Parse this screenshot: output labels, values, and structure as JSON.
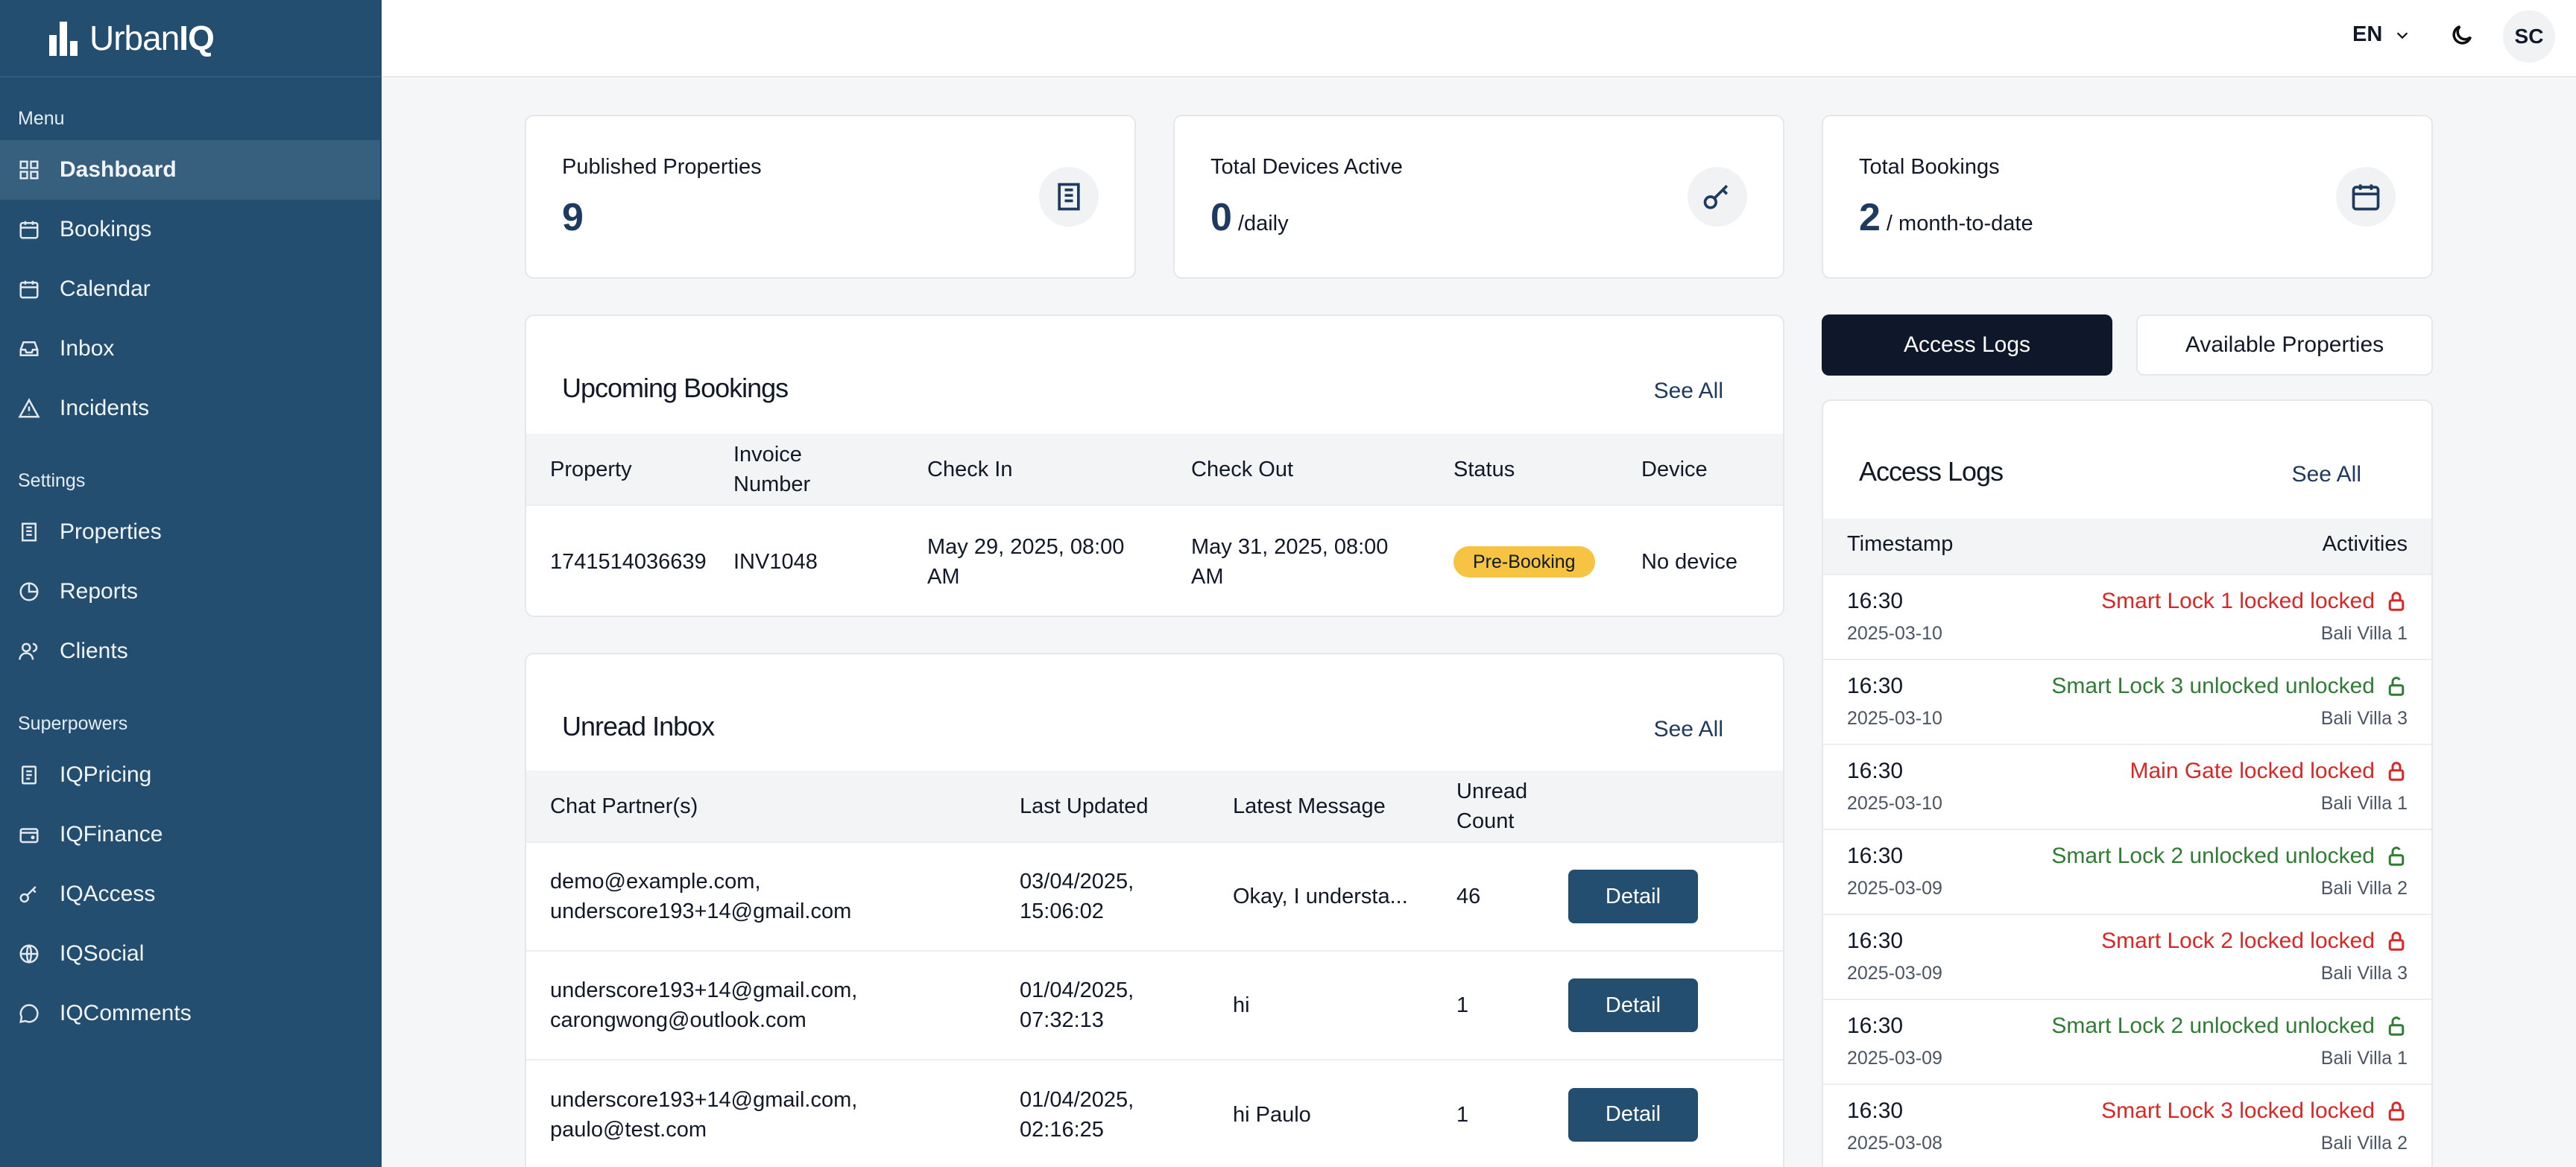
{
  "app": {
    "logo_text_bold": "Urban",
    "logo_text_accent": "IQ"
  },
  "sidebar": {
    "sections": [
      {
        "label": "Menu",
        "items": [
          {
            "label": "Dashboard",
            "icon": "grid-icon",
            "active": true
          },
          {
            "label": "Bookings",
            "icon": "calendar-icon"
          },
          {
            "label": "Calendar",
            "icon": "calendar-icon"
          },
          {
            "label": "Inbox",
            "icon": "inbox-icon"
          },
          {
            "label": "Incidents",
            "icon": "warning-icon"
          }
        ]
      },
      {
        "label": "Settings",
        "items": [
          {
            "label": "Properties",
            "icon": "building-icon"
          },
          {
            "label": "Reports",
            "icon": "pie-chart-icon"
          },
          {
            "label": "Clients",
            "icon": "users-icon"
          }
        ]
      },
      {
        "label": "Superpowers",
        "items": [
          {
            "label": "IQPricing",
            "icon": "receipt-icon"
          },
          {
            "label": "IQFinance",
            "icon": "wallet-icon"
          },
          {
            "label": "IQAccess",
            "icon": "key-icon"
          },
          {
            "label": "IQSocial",
            "icon": "globe-icon"
          },
          {
            "label": "IQComments",
            "icon": "chat-icon"
          }
        ]
      }
    ]
  },
  "topbar": {
    "language": "EN",
    "avatar_initials": "SC"
  },
  "stats": [
    {
      "title": "Published Properties",
      "value": "9",
      "unit": "",
      "icon": "building-icon"
    },
    {
      "title": "Total Devices Active",
      "value": "0",
      "unit": "/daily",
      "icon": "key-icon"
    },
    {
      "title": "Total Bookings",
      "value": "2",
      "unit": "/ month-to-date",
      "icon": "calendar-icon"
    }
  ],
  "upcoming": {
    "title": "Upcoming Bookings",
    "see_all": "See All",
    "headers": [
      "Property",
      "Invoice Number",
      "Check In",
      "Check Out",
      "Status",
      "Device"
    ],
    "rows": [
      {
        "property": "1741514036639",
        "invoice": "INV1048",
        "check_in": "May 29, 2025, 08:00 AM",
        "check_out": "May 31, 2025, 08:00 AM",
        "status": "Pre-Booking",
        "device": "No device"
      }
    ]
  },
  "inbox": {
    "title": "Unread Inbox",
    "see_all": "See All",
    "headers": [
      "Chat Partner(s)",
      "Last Updated",
      "Latest Message",
      "Unread Count",
      ""
    ],
    "detail_label": "Detail",
    "rows": [
      {
        "partners": "demo@example.com, underscore193+14@gmail.com",
        "updated": "03/04/2025, 15:06:02",
        "message": "Okay, I understa...",
        "count": "46"
      },
      {
        "partners": "underscore193+14@gmail.com, carongwong@outlook.com",
        "updated": "01/04/2025, 07:32:13",
        "message": "hi",
        "count": "1"
      },
      {
        "partners": "underscore193+14@gmail.com, paulo@test.com",
        "updated": "01/04/2025, 02:16:25",
        "message": "hi Paulo",
        "count": "1"
      }
    ]
  },
  "tabs": [
    {
      "label": "Access Logs",
      "active": true
    },
    {
      "label": "Available Properties",
      "active": false
    }
  ],
  "access_logs": {
    "title": "Access Logs",
    "see_all": "See All",
    "headers": [
      "Timestamp",
      "Activities"
    ],
    "rows": [
      {
        "time": "16:30",
        "date": "2025-03-10",
        "activity": "Smart Lock 1 locked locked",
        "property": "Bali Villa 1",
        "state": "locked"
      },
      {
        "time": "16:30",
        "date": "2025-03-10",
        "activity": "Smart Lock 3 unlocked unlocked",
        "property": "Bali Villa 3",
        "state": "unlocked"
      },
      {
        "time": "16:30",
        "date": "2025-03-10",
        "activity": "Main Gate locked locked",
        "property": "Bali Villa 1",
        "state": "locked"
      },
      {
        "time": "16:30",
        "date": "2025-03-09",
        "activity": "Smart Lock 2 unlocked unlocked",
        "property": "Bali Villa 2",
        "state": "unlocked"
      },
      {
        "time": "16:30",
        "date": "2025-03-09",
        "activity": "Smart Lock 2 locked locked",
        "property": "Bali Villa 3",
        "state": "locked"
      },
      {
        "time": "16:30",
        "date": "2025-03-09",
        "activity": "Smart Lock 2 unlocked unlocked",
        "property": "Bali Villa 1",
        "state": "unlocked"
      },
      {
        "time": "16:30",
        "date": "2025-03-08",
        "activity": "Smart Lock 3 locked locked",
        "property": "Bali Villa 2",
        "state": "locked"
      }
    ]
  },
  "colors": {
    "sidebar": "#234e70",
    "active_tab": "#0f172a",
    "locked": "#dc2626",
    "unlocked": "#2e7d32",
    "badge": "#f6c342"
  }
}
